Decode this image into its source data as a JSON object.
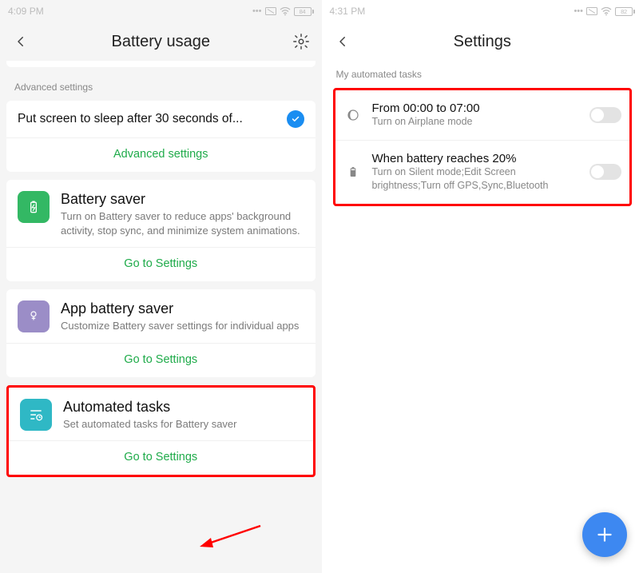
{
  "left": {
    "status_time": "4:09 PM",
    "battery": "84",
    "title": "Battery usage",
    "adv_label": "Advanced settings",
    "sleep_row": "Put screen to sleep after 30 seconds of...",
    "adv_link": "Advanced settings",
    "feature_saver": {
      "title": "Battery saver",
      "desc": "Turn on Battery saver to reduce apps' background activity, stop sync, and minimize system animations.",
      "link": "Go to Settings"
    },
    "feature_app": {
      "title": "App battery saver",
      "desc": "Customize Battery saver settings for individual apps",
      "link": "Go to Settings"
    },
    "feature_auto": {
      "title": "Automated tasks",
      "desc": "Set automated tasks for Battery saver",
      "link": "Go to Settings"
    }
  },
  "right": {
    "status_time": "4:31 PM",
    "battery": "82",
    "title": "Settings",
    "section": "My automated tasks",
    "task1": {
      "title": "From 00:00 to 07:00",
      "desc": "Turn on Airplane mode"
    },
    "task2": {
      "title": "When battery reaches 20%",
      "desc": "Turn on Silent mode;Edit Screen brightness;Turn off GPS,Sync,Bluetooth"
    }
  }
}
